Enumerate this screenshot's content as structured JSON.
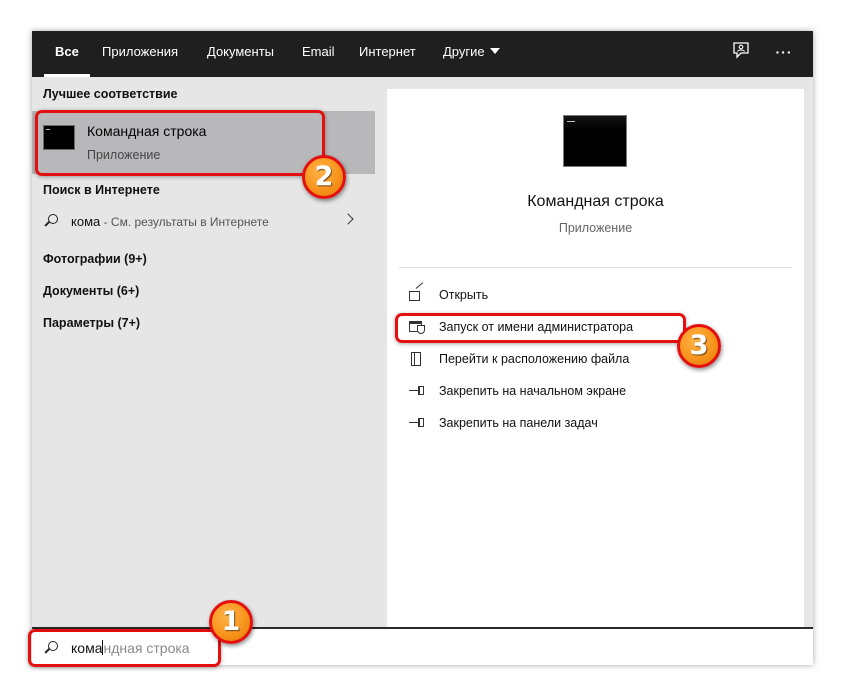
{
  "tabs": [
    {
      "label": "Все",
      "active": true
    },
    {
      "label": "Приложения",
      "active": false
    },
    {
      "label": "Документы",
      "active": false
    },
    {
      "label": "Email",
      "active": false
    },
    {
      "label": "Интернет",
      "active": false
    },
    {
      "label": "Другие",
      "active": false
    }
  ],
  "toolbar_icons": [
    "feedback-icon",
    "more-options-icon"
  ],
  "more_glyph": "···",
  "left": {
    "best_match_title": "Лучшее соответствие",
    "best_match": {
      "name": "Командная строка",
      "type": "Приложение",
      "icon": "command-prompt-icon"
    },
    "web_title": "Поиск в Интернете",
    "web_query": "кома",
    "web_hint": " - См. результаты в Интернете",
    "categories": [
      "Фотографии (9+)",
      "Документы (6+)",
      "Параметры (7+)"
    ]
  },
  "details": {
    "name": "Командная строка",
    "type": "Приложение",
    "actions": [
      {
        "label": "Открыть",
        "icon": "open-icon"
      },
      {
        "label": "Запуск от имени администратора",
        "icon": "run-as-admin-icon"
      },
      {
        "label": "Перейти к расположению файла",
        "icon": "file-location-icon"
      },
      {
        "label": "Закрепить на начальном экране",
        "icon": "pin-icon"
      },
      {
        "label": "Закрепить на панели задач",
        "icon": "pin-icon"
      }
    ]
  },
  "search": {
    "typed": "кома",
    "suggestion": "ндная строка"
  },
  "annotations": [
    "1",
    "2",
    "3"
  ],
  "colors": {
    "tabbar": "#1f1f1f",
    "pane": "#e6e6e6",
    "selected": "#b8b8bb",
    "highlight": "#e41010",
    "badge": "#f7941d"
  }
}
